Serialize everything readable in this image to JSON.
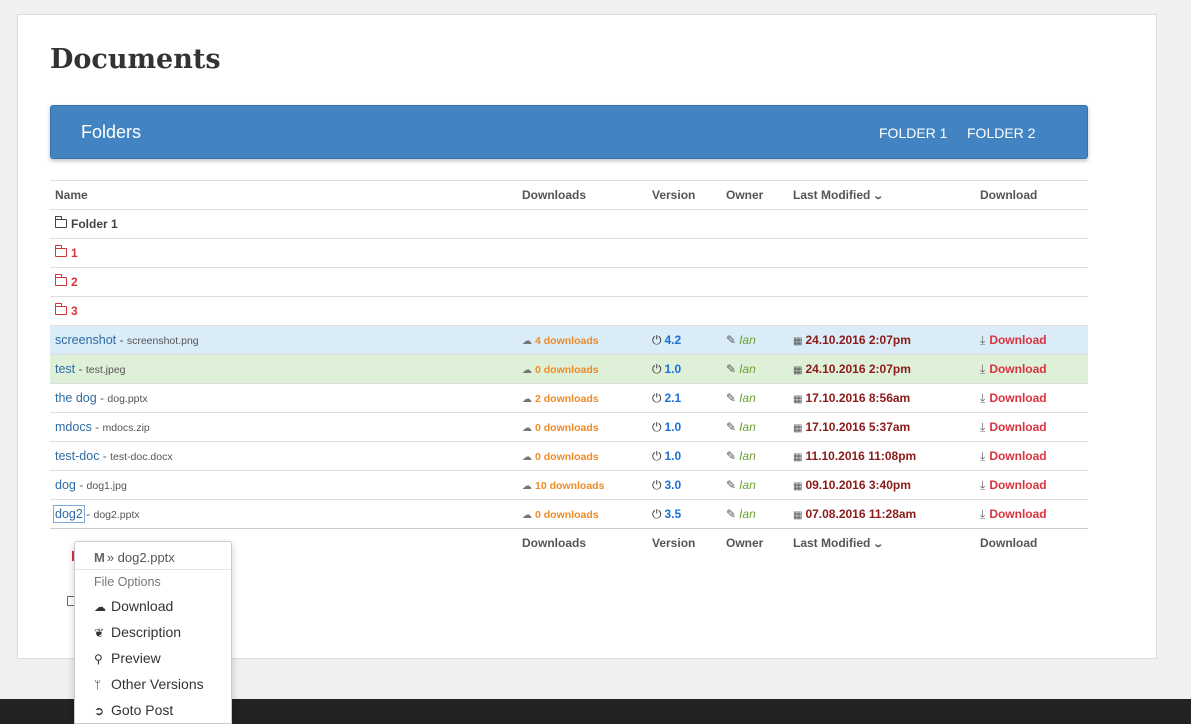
{
  "page": {
    "title": "Documents"
  },
  "folders_bar": {
    "title": "Folders",
    "links": [
      "FOLDER 1",
      "FOLDER 2"
    ]
  },
  "table": {
    "columns": {
      "name": "Name",
      "downloads": "Downloads",
      "version": "Version",
      "owner": "Owner",
      "last_modified": "Last Modified",
      "download": "Download"
    },
    "current_folder": "Folder 1",
    "subfolders": [
      "1",
      "2",
      "3"
    ],
    "files": [
      {
        "name": "screenshot",
        "ext": "screenshot.png",
        "downloads": "4 downloads",
        "version": "4.2",
        "owner": "Ian",
        "modified": "24.10.2016 2:07pm",
        "download": "Download",
        "highlight": "info"
      },
      {
        "name": "test",
        "ext": "test.jpeg",
        "downloads": "0 downloads",
        "version": "1.0",
        "owner": "Ian",
        "modified": "24.10.2016 2:07pm",
        "download": "Download",
        "highlight": "success"
      },
      {
        "name": "the dog",
        "ext": "dog.pptx",
        "downloads": "2 downloads",
        "version": "2.1",
        "owner": "Ian",
        "modified": "17.10.2016 8:56am",
        "download": "Download",
        "highlight": ""
      },
      {
        "name": "mdocs",
        "ext": "mdocs.zip",
        "downloads": "0 downloads",
        "version": "1.0",
        "owner": "Ian",
        "modified": "17.10.2016 5:37am",
        "download": "Download",
        "highlight": ""
      },
      {
        "name": "test-doc",
        "ext": "test-doc.docx",
        "downloads": "0 downloads",
        "version": "1.0",
        "owner": "Ian",
        "modified": "11.10.2016 11:08pm",
        "download": "Download",
        "highlight": ""
      },
      {
        "name": "dog",
        "ext": "dog1.jpg",
        "downloads": "10 downloads",
        "version": "3.0",
        "owner": "Ian",
        "modified": "09.10.2016 3:40pm",
        "download": "Download",
        "highlight": ""
      },
      {
        "name": "dog2",
        "ext": "dog2.pptx",
        "downloads": "0 downloads",
        "version": "3.5",
        "owner": "Ian",
        "modified": "07.08.2016 11:28am",
        "download": "Download",
        "highlight": ""
      }
    ],
    "separator": " - "
  },
  "context_menu": {
    "header": "» dog2.pptx",
    "section": "File Options",
    "items": [
      "Download",
      "Description",
      "Preview",
      "Other Versions",
      "Goto Post"
    ]
  }
}
